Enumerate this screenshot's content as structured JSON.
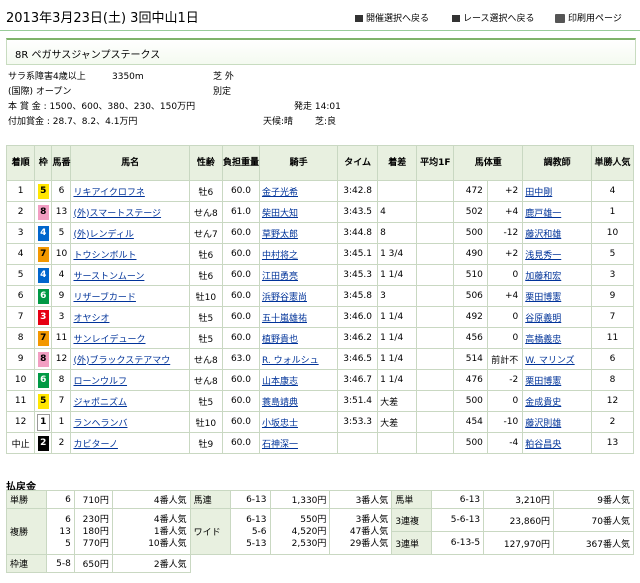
{
  "header": {
    "title": "2013年3月23日(土) 3回中山1日",
    "nav_meeting": "開催選択へ戻る",
    "nav_race": "レース選択へ戻る",
    "nav_print": "印刷用ページ"
  },
  "race": {
    "name": "8R ペガサスジャンプステークス",
    "line1_left": "サラ系障害4歳以上",
    "line1_dist": "3350m",
    "line1_course": "芝 外",
    "line2_left": "(国際) オープン",
    "line2_cond": "別定",
    "prize": "本 賞 金 : 1500、600、380、230、150万円",
    "start": "発走 14:01",
    "addprize": "付加賞金 : 28.7、8.2、4.1万円",
    "weather": "天候:晴",
    "track": "芝:良"
  },
  "table": {
    "headers": [
      "着順",
      "枠",
      "馬番",
      "馬名",
      "性齢",
      "負担重量",
      "騎手",
      "タイム",
      "着差",
      "平均1F",
      "馬体重",
      "",
      "調教師",
      "単勝人気"
    ],
    "rows": [
      {
        "pos": "1",
        "waku": "5",
        "num": "6",
        "horse": "リキアイクロフネ",
        "sex": "牡6",
        "wt": "60.0",
        "jockey": "金子光希",
        "time": "3:42.8",
        "margin": "",
        "f": "",
        "bw": "472",
        "bwd": "+2",
        "trainer": "田中剛",
        "pop": "4"
      },
      {
        "pos": "2",
        "waku": "8",
        "num": "13",
        "horse": "(外)スマートステージ",
        "sex": "せん8",
        "wt": "61.0",
        "jockey": "柴田大知",
        "time": "3:43.5",
        "margin": "4",
        "f": "",
        "bw": "502",
        "bwd": "+4",
        "trainer": "鹿戸雄一",
        "pop": "1"
      },
      {
        "pos": "3",
        "waku": "4",
        "num": "5",
        "horse": "(外)レンディル",
        "sex": "せん7",
        "wt": "60.0",
        "jockey": "草野太郎",
        "time": "3:44.8",
        "margin": "8",
        "f": "",
        "bw": "500",
        "bwd": "-12",
        "trainer": "藤沢和雄",
        "pop": "10"
      },
      {
        "pos": "4",
        "waku": "7",
        "num": "10",
        "horse": "トウシンボルト",
        "sex": "牡6",
        "wt": "60.0",
        "jockey": "中村将之",
        "time": "3:45.1",
        "margin": "1 3/4",
        "f": "",
        "bw": "490",
        "bwd": "+2",
        "trainer": "浅見秀一",
        "pop": "5"
      },
      {
        "pos": "5",
        "waku": "4",
        "num": "4",
        "horse": "サーストンムーン",
        "sex": "牡6",
        "wt": "60.0",
        "jockey": "江田勇亮",
        "time": "3:45.3",
        "margin": "1 1/4",
        "f": "",
        "bw": "510",
        "bwd": "0",
        "trainer": "加藤和宏",
        "pop": "3"
      },
      {
        "pos": "6",
        "waku": "6",
        "num": "9",
        "horse": "リザーブカード",
        "sex": "牡10",
        "wt": "60.0",
        "jockey": "浜野谷憲尚",
        "time": "3:45.8",
        "margin": "3",
        "f": "",
        "bw": "506",
        "bwd": "+4",
        "trainer": "栗田博憲",
        "pop": "9"
      },
      {
        "pos": "7",
        "waku": "3",
        "num": "3",
        "horse": "オヤシオ",
        "sex": "牡5",
        "wt": "60.0",
        "jockey": "五十嵐雄祐",
        "time": "3:46.0",
        "margin": "1 1/4",
        "f": "",
        "bw": "492",
        "bwd": "0",
        "trainer": "谷原義明",
        "pop": "7"
      },
      {
        "pos": "8",
        "waku": "7",
        "num": "11",
        "horse": "サンレイデューク",
        "sex": "牡5",
        "wt": "60.0",
        "jockey": "植野貴也",
        "time": "3:46.2",
        "margin": "1 1/4",
        "f": "",
        "bw": "456",
        "bwd": "0",
        "trainer": "高橋義忠",
        "pop": "11"
      },
      {
        "pos": "9",
        "waku": "8",
        "num": "12",
        "horse": "(外)ブラックステアマウ",
        "sex": "せん8",
        "wt": "63.0",
        "jockey": "R. ウォルシュ",
        "time": "3:46.5",
        "margin": "1 1/4",
        "f": "",
        "bw": "514",
        "bwd": "前計不",
        "trainer": "W. マリンズ",
        "pop": "6"
      },
      {
        "pos": "10",
        "waku": "6",
        "num": "8",
        "horse": "ローンウルフ",
        "sex": "せん8",
        "wt": "60.0",
        "jockey": "山本康志",
        "time": "3:46.7",
        "margin": "1 1/4",
        "f": "",
        "bw": "476",
        "bwd": "-2",
        "trainer": "栗田博憲",
        "pop": "8"
      },
      {
        "pos": "11",
        "waku": "5",
        "num": "7",
        "horse": "ジャポニズム",
        "sex": "牡5",
        "wt": "60.0",
        "jockey": "蓑島靖典",
        "time": "3:51.4",
        "margin": "大差",
        "f": "",
        "bw": "500",
        "bwd": "0",
        "trainer": "金成貴史",
        "pop": "12"
      },
      {
        "pos": "12",
        "waku": "1",
        "num": "1",
        "horse": "ランヘランバ",
        "sex": "牡10",
        "wt": "60.0",
        "jockey": "小坂忠士",
        "time": "3:53.3",
        "margin": "大差",
        "f": "",
        "bw": "454",
        "bwd": "-10",
        "trainer": "藤沢則雄",
        "pop": "2"
      },
      {
        "pos": "中止",
        "waku": "2",
        "num": "2",
        "horse": "カビターノ",
        "sex": "牡9",
        "wt": "60.0",
        "jockey": "石神深一",
        "time": "",
        "margin": "",
        "f": "",
        "bw": "500",
        "bwd": "-4",
        "trainer": "粕谷昌央",
        "pop": "13"
      }
    ]
  },
  "payout": {
    "title": "払戻金",
    "tansho": {
      "label": "単勝",
      "combo": "6",
      "pay": "710円",
      "pop": "4番人気"
    },
    "fukusho": {
      "label": "複勝",
      "combos": [
        "6",
        "13",
        "5"
      ],
      "pays": [
        "230円",
        "180円",
        "770円"
      ],
      "pops": [
        "4番人気",
        "1番人気",
        "10番人気"
      ]
    },
    "wakuren": {
      "label": "枠連",
      "combo": "5-8",
      "pay": "650円",
      "pop": "2番人気"
    },
    "umaren": {
      "label": "馬連",
      "combo": "6-13",
      "pay": "1,330円",
      "pop": "3番人気"
    },
    "wide": {
      "label": "ワイド",
      "combos": [
        "6-13",
        "5-6",
        "5-13"
      ],
      "pays": [
        "550円",
        "4,520円",
        "2,530円"
      ],
      "pops": [
        "3番人気",
        "47番人気",
        "29番人気"
      ]
    },
    "umatan": {
      "label": "馬単",
      "combo": "6-13",
      "pay": "3,210円",
      "pop": "9番人気"
    },
    "sanfuku": {
      "label": "3連複",
      "combo": "5-6-13",
      "pay": "23,860円",
      "pop": "70番人気"
    },
    "santan": {
      "label": "3連単",
      "combo": "6-13-5",
      "pay": "127,970円",
      "pop": "367番人気"
    }
  },
  "colors": {
    "waku1": "#ffffff",
    "waku2": "#000000",
    "waku3": "#e60012",
    "waku4": "#0066cc",
    "waku5": "#ffe600",
    "waku6": "#009944",
    "waku7": "#f39800",
    "waku8": "#f29ec2"
  }
}
